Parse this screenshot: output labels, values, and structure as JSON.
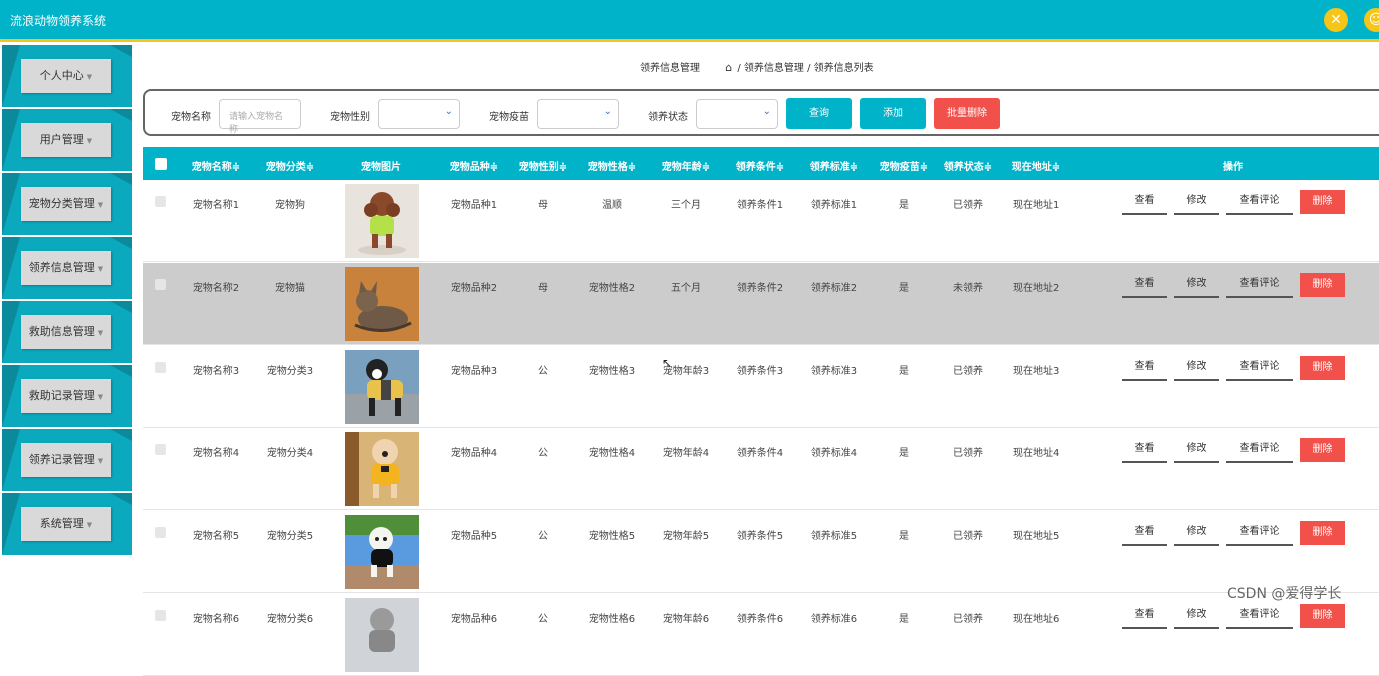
{
  "app": {
    "title": "流浪动物领养系统"
  },
  "sidebar": {
    "items": [
      {
        "label": "个人中心"
      },
      {
        "label": "用户管理"
      },
      {
        "label": "宠物分类管理"
      },
      {
        "label": "领养信息管理"
      },
      {
        "label": "救助信息管理"
      },
      {
        "label": "救助记录管理"
      },
      {
        "label": "领养记录管理"
      },
      {
        "label": "系统管理"
      }
    ],
    "caret": "▼"
  },
  "breadcrumb": {
    "section": "领养信息管理",
    "path": "/ 领养信息管理 / 领养信息列表"
  },
  "search": {
    "name_label": "宠物名称",
    "name_placeholder": "请输入宠物名称",
    "gender_label": "宠物性别",
    "vaccine_label": "宠物疫苗",
    "status_label": "领养状态",
    "query_label": "查询",
    "add_label": "添加",
    "batch_delete_label": "批量删除"
  },
  "table": {
    "headers": [
      "宠物名称≑",
      "宠物分类≑",
      "宠物图片",
      "宠物品种≑",
      "宠物性别≑",
      "宠物性格≑",
      "宠物年龄≑",
      "领养条件≑",
      "领养标准≑",
      "宠物疫苗≑",
      "领养状态≑",
      "现在地址≑",
      "操作"
    ],
    "actions": {
      "view": "查看",
      "edit": "修改",
      "comments": "查看评论",
      "delete": "删除"
    },
    "rows": [
      {
        "name": "宠物名称1",
        "category": "宠物狗",
        "breed": "宠物品种1",
        "gender": "母",
        "personality": "温顺",
        "age": "三个月",
        "condition": "领养条件1",
        "standard": "领养标准1",
        "vaccine": "是",
        "status": "已领养",
        "address": "现在地址1",
        "img": "poodle"
      },
      {
        "name": "宠物名称2",
        "category": "宠物猫",
        "breed": "宠物品种2",
        "gender": "母",
        "personality": "宠物性格2",
        "age": "五个月",
        "condition": "领养条件2",
        "standard": "领养标准2",
        "vaccine": "是",
        "status": "未领养",
        "address": "现在地址2",
        "img": "cat"
      },
      {
        "name": "宠物名称3",
        "category": "宠物分类3",
        "breed": "宠物品种3",
        "gender": "公",
        "personality": "宠物性格3",
        "age": "宠物年龄3",
        "condition": "领养条件3",
        "standard": "领养标准3",
        "vaccine": "是",
        "status": "已领养",
        "address": "现在地址3",
        "img": "bw-dog"
      },
      {
        "name": "宠物名称4",
        "category": "宠物分类4",
        "breed": "宠物品种4",
        "gender": "公",
        "personality": "宠物性格4",
        "age": "宠物年龄4",
        "condition": "领养条件4",
        "standard": "领养标准4",
        "vaccine": "是",
        "status": "已领养",
        "address": "现在地址4",
        "img": "teddy"
      },
      {
        "name": "宠物名称5",
        "category": "宠物分类5",
        "breed": "宠物品种5",
        "gender": "公",
        "personality": "宠物性格5",
        "age": "宠物年龄5",
        "condition": "领养条件5",
        "standard": "领养标准5",
        "vaccine": "是",
        "status": "已领养",
        "address": "现在地址5",
        "img": "white-dog"
      },
      {
        "name": "宠物名称6",
        "category": "宠物分类6",
        "breed": "宠物品种6",
        "gender": "公",
        "personality": "宠物性格6",
        "age": "宠物年龄6",
        "condition": "领养条件6",
        "standard": "领养标准6",
        "vaccine": "是",
        "status": "已领养",
        "address": "现在地址6",
        "img": "gray-dog"
      }
    ]
  },
  "watermark": "CSDN @爱得学长",
  "colors": {
    "primary": "#00b3c9",
    "accent": "#f5c518",
    "danger": "#f2504a",
    "row_highlight": "#cccccc"
  }
}
